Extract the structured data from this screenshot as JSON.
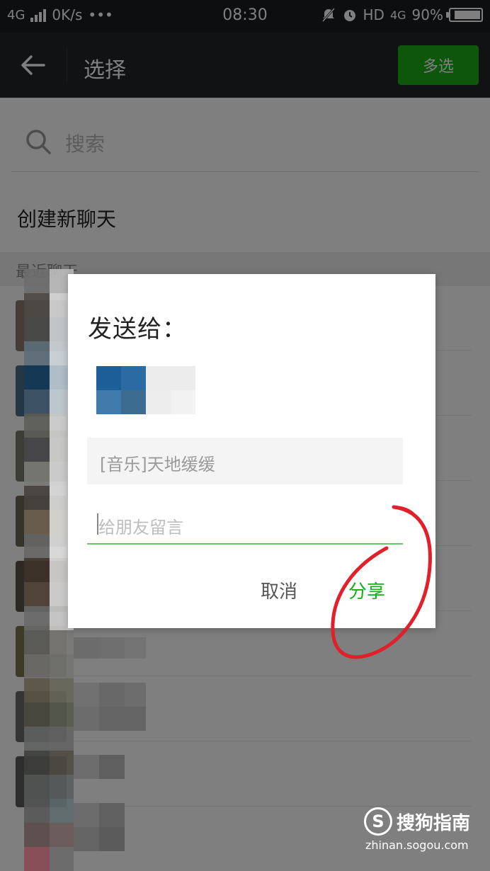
{
  "status_bar": {
    "network": "4G",
    "speed": "0K/s",
    "dots": "•••",
    "time": "08:30",
    "hd": "HD",
    "network_right": "4G",
    "battery": "90%",
    "battery_level": 0.9
  },
  "header": {
    "title": "选择",
    "multi_select_label": "多选"
  },
  "search": {
    "placeholder": "搜索"
  },
  "list": {
    "create_new_chat": "创建新聊天",
    "section_label": "最近聊天"
  },
  "dialog": {
    "title": "发送给：",
    "shared_item": "[音乐]天地缓缓",
    "message_placeholder": "给朋友留言",
    "cancel_label": "取消",
    "share_label": "分享"
  },
  "watermark": {
    "logo_letter": "S",
    "brand": "搜狗指南",
    "url": "zhinan.sogou.com"
  },
  "colors": {
    "accent_green": "#1aad19",
    "annotation_red": "#e0202a",
    "topbar": "#222426"
  }
}
